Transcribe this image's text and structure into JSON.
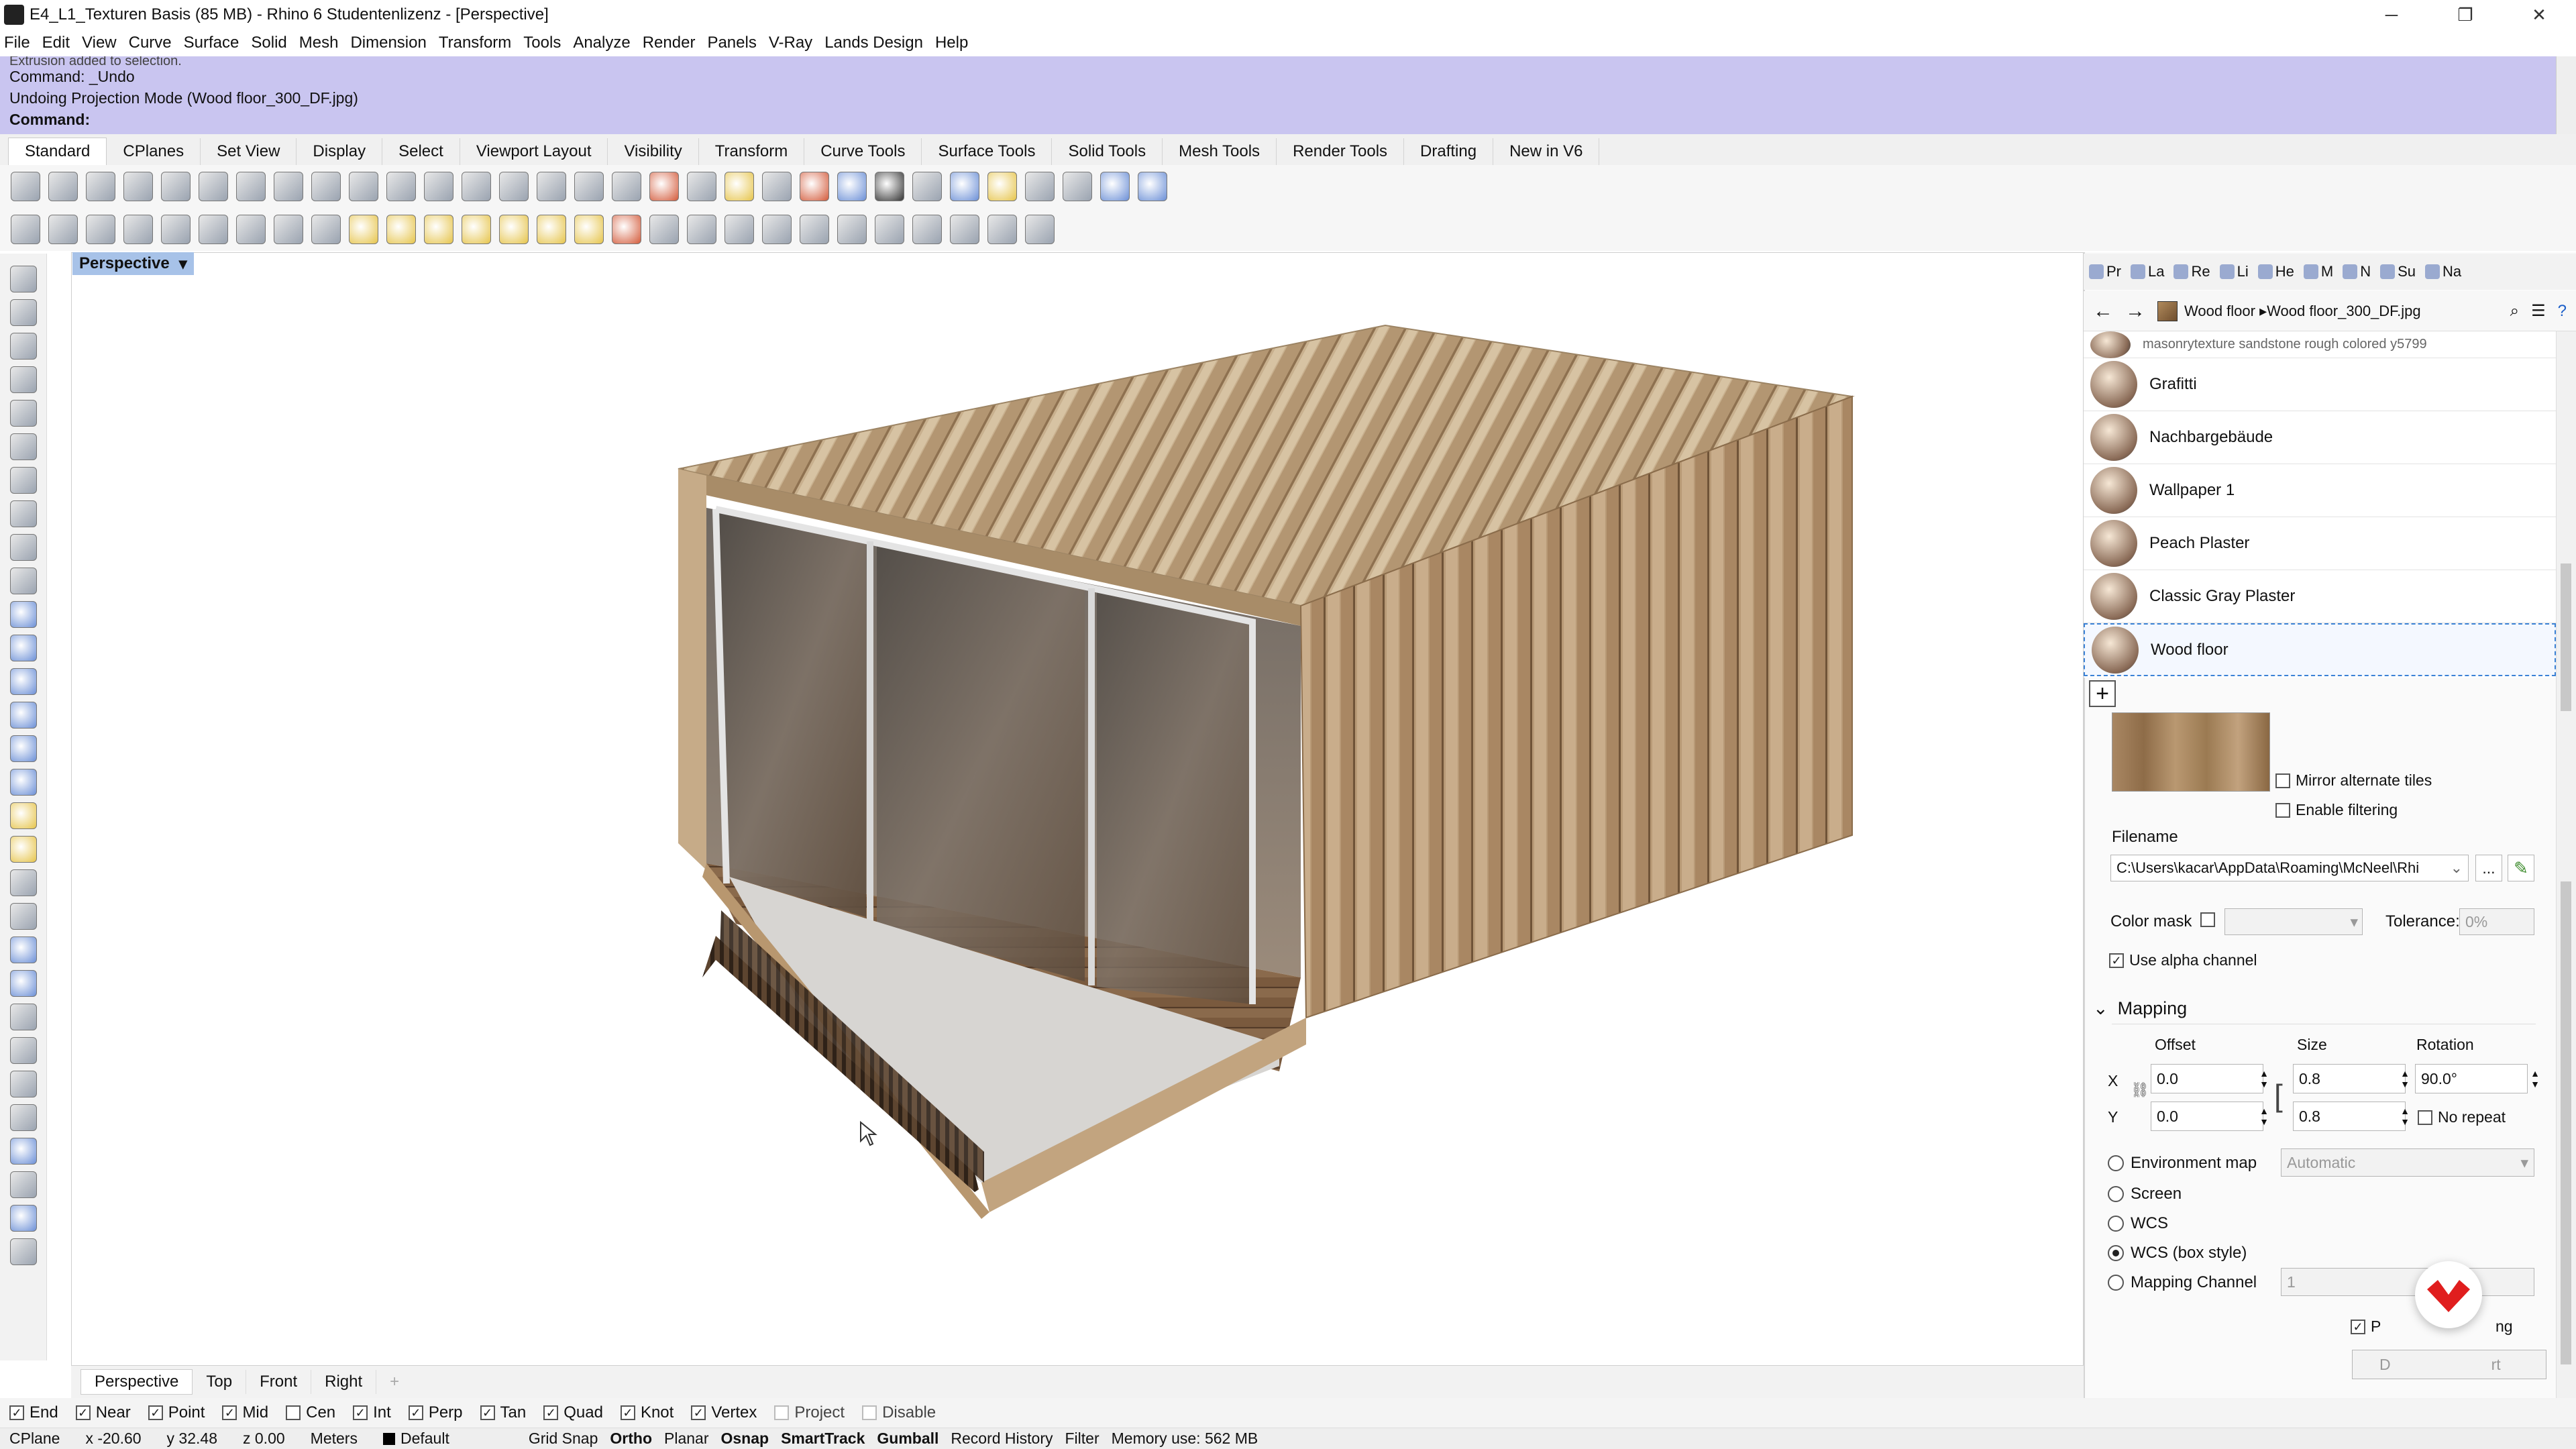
{
  "window": {
    "title": "E4_L1_Texturen Basis (85 MB) - Rhino 6 Studentenlizenz - [Perspective]",
    "buttons": [
      "─",
      "❐",
      "✕"
    ]
  },
  "menu": [
    "File",
    "Edit",
    "View",
    "Curve",
    "Surface",
    "Solid",
    "Mesh",
    "Dimension",
    "Transform",
    "Tools",
    "Analyze",
    "Render",
    "Panels",
    "V-Ray",
    "Lands Design",
    "Help"
  ],
  "command": {
    "line0": "Extrusion added to selection.",
    "line1": "Command: _Undo",
    "line2": "Undoing Projection Mode (Wood floor_300_DF.jpg)",
    "prompt": "Command:"
  },
  "toolbar_tabs": [
    "Standard",
    "CPlanes",
    "Set View",
    "Display",
    "Select",
    "Viewport Layout",
    "Visibility",
    "Transform",
    "Curve Tools",
    "Surface Tools",
    "Solid Tools",
    "Mesh Tools",
    "Render Tools",
    "Drafting",
    "New in V6"
  ],
  "viewport": {
    "label": "Perspective",
    "dropdown": "▾",
    "tabs": [
      "Perspective",
      "Top",
      "Front",
      "Right"
    ],
    "add_tab": "+"
  },
  "snaps": [
    {
      "label": "End",
      "checked": true
    },
    {
      "label": "Near",
      "checked": true
    },
    {
      "label": "Point",
      "checked": true
    },
    {
      "label": "Mid",
      "checked": true
    },
    {
      "label": "Cen",
      "checked": false
    },
    {
      "label": "Int",
      "checked": true
    },
    {
      "label": "Perp",
      "checked": true
    },
    {
      "label": "Tan",
      "checked": true
    },
    {
      "label": "Quad",
      "checked": true
    },
    {
      "label": "Knot",
      "checked": true
    },
    {
      "label": "Vertex",
      "checked": true
    },
    {
      "label": "Project",
      "checked": false
    },
    {
      "label": "Disable",
      "checked": false
    }
  ],
  "status": {
    "cplane": "CPlane",
    "x": "x -20.60",
    "y": "y 32.48",
    "z": "z 0.00",
    "units": "Meters",
    "layer": "Default",
    "modes": [
      "Grid Snap",
      "Ortho",
      "Planar",
      "Osnap",
      "SmartTrack",
      "Gumball",
      "Record History",
      "Filter"
    ],
    "memory": "Memory use: 562 MB"
  },
  "panel": {
    "tabs": [
      "Pr",
      "La",
      "Re",
      "Li",
      "He",
      "M",
      "N",
      "Su",
      "Na"
    ],
    "breadcrumb": "Wood floor ▸Wood floor_300_DF.jpg",
    "materials": [
      {
        "name": "masonrytexture sandstone rough colored y5799",
        "partial": true
      },
      {
        "name": "Grafitti"
      },
      {
        "name": "Nachbargebäude"
      },
      {
        "name": "Wallpaper 1"
      },
      {
        "name": "Peach Plaster"
      },
      {
        "name": "Classic Gray Plaster"
      },
      {
        "name": "Wood floor",
        "selected": true
      }
    ],
    "add": "+",
    "mirror_label": "Mirror alternate tiles",
    "filtering_label": "Enable filtering",
    "filename_label": "Filename",
    "filename_value": "C:\\Users\\kacar\\AppData\\Roaming\\McNeel\\Rhi",
    "browse": "...",
    "colormask_label": "Color mask",
    "tolerance_label": "Tolerance:",
    "tolerance_value": "0%",
    "alpha_label": "Use alpha channel",
    "mapping_title": "Mapping",
    "offset_label": "Offset",
    "size_label": "Size",
    "rotation_label": "Rotation",
    "x_label": "X",
    "y_label": "Y",
    "offset_x": "0.0",
    "offset_y": "0.0",
    "size_x": "0.8",
    "size_y": "0.8",
    "rotation": "90.0°",
    "norepeat_label": "No repeat",
    "envmap_label": "Environment map",
    "envmap_value": "Automatic",
    "screen_label": "Screen",
    "wcs_label": "WCS",
    "wcsbox_label": "WCS (box style)",
    "channel_label": "Mapping Channel",
    "channel_value": "1",
    "partial_p": "P",
    "partial_ng": "ng",
    "partial_d": "D",
    "partial_rt": "rt"
  },
  "colors": {
    "command_bg": "#c9c5f0",
    "viewport_label_bg": "#a7c2e8",
    "selection": "#3b82d6",
    "logo_red": "#e01e1e"
  }
}
